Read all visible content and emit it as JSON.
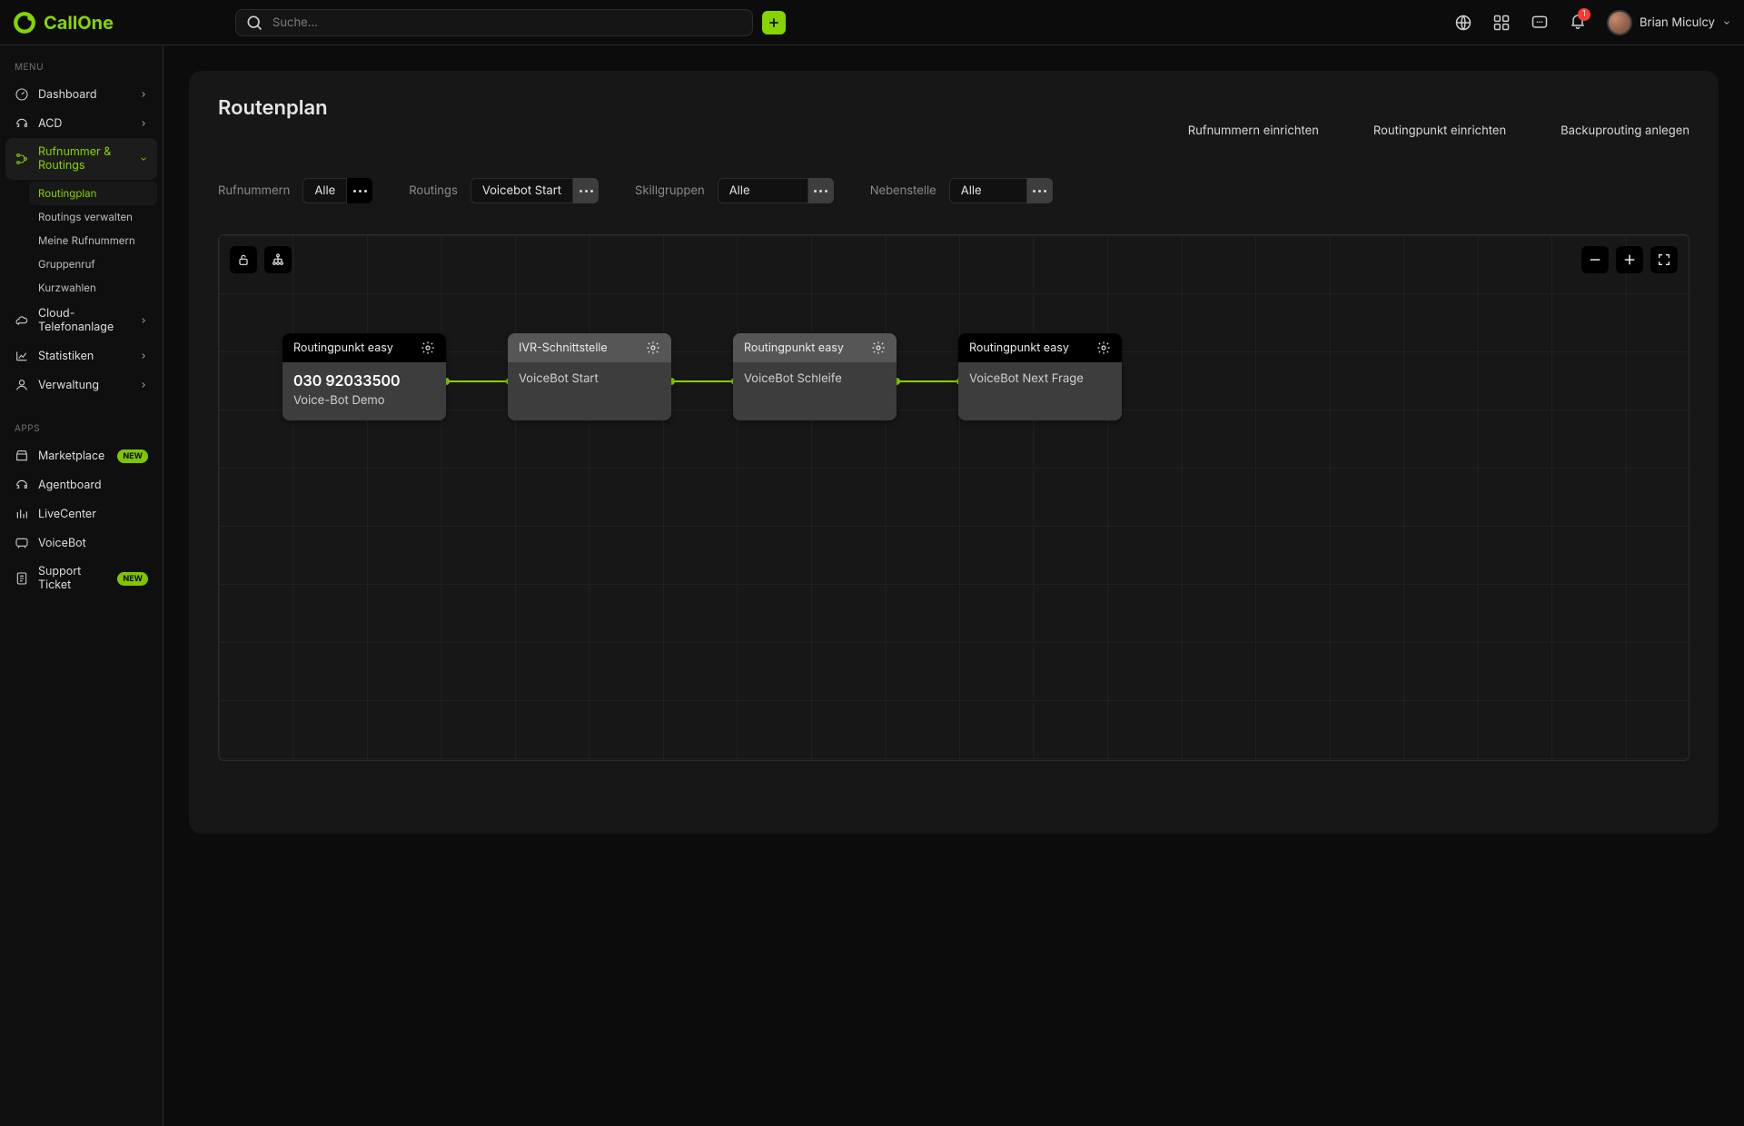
{
  "brand": "CallOne",
  "search": {
    "placeholder": "Suche…"
  },
  "user": {
    "name": "Brian Miculcy"
  },
  "notifications": {
    "count": 1
  },
  "sidebar": {
    "section_menu": "MENU",
    "section_apps": "APPS",
    "items": [
      {
        "label": "Dashboard"
      },
      {
        "label": "ACD"
      },
      {
        "label": "Rufnummer & Routings"
      },
      {
        "label": "Cloud-Telefonanlage"
      },
      {
        "label": "Statistiken"
      },
      {
        "label": "Verwaltung"
      }
    ],
    "sub_routing": [
      {
        "label": "Routingplan"
      },
      {
        "label": "Routings verwalten"
      },
      {
        "label": "Meine Rufnummern"
      },
      {
        "label": "Gruppenruf"
      },
      {
        "label": "Kurzwahlen"
      }
    ],
    "apps": [
      {
        "label": "Marketplace",
        "badge": "NEW"
      },
      {
        "label": "Agentboard"
      },
      {
        "label": "LiveCenter"
      },
      {
        "label": "VoiceBot"
      },
      {
        "label": "Support Ticket",
        "badge": "NEW"
      }
    ]
  },
  "page": {
    "title": "Routenplan",
    "actions": [
      "Rufnummern einrichten",
      "Routingpunkt einrichten",
      "Backuprouting anlegen"
    ]
  },
  "filters": {
    "rufnummern": {
      "label": "Rufnummern",
      "value": "Alle"
    },
    "routings": {
      "label": "Routings",
      "value": "Voicebot Start"
    },
    "skill": {
      "label": "Skillgruppen",
      "value": "Alle"
    },
    "neben": {
      "label": "Nebenstelle",
      "value": "Alle"
    }
  },
  "nodes": [
    {
      "kind": "dark",
      "title": "Routingpunkt easy",
      "line1": "030 92033500",
      "line2": "Voice-Bot Demo"
    },
    {
      "kind": "grey",
      "title": "IVR-Schnittstelle",
      "line1": "VoiceBot Start"
    },
    {
      "kind": "grey",
      "title": "Routingpunkt easy",
      "line1": "VoiceBot Schleife"
    },
    {
      "kind": "dark",
      "title": "Routingpunkt easy",
      "line1": "VoiceBot Next Frage"
    }
  ]
}
